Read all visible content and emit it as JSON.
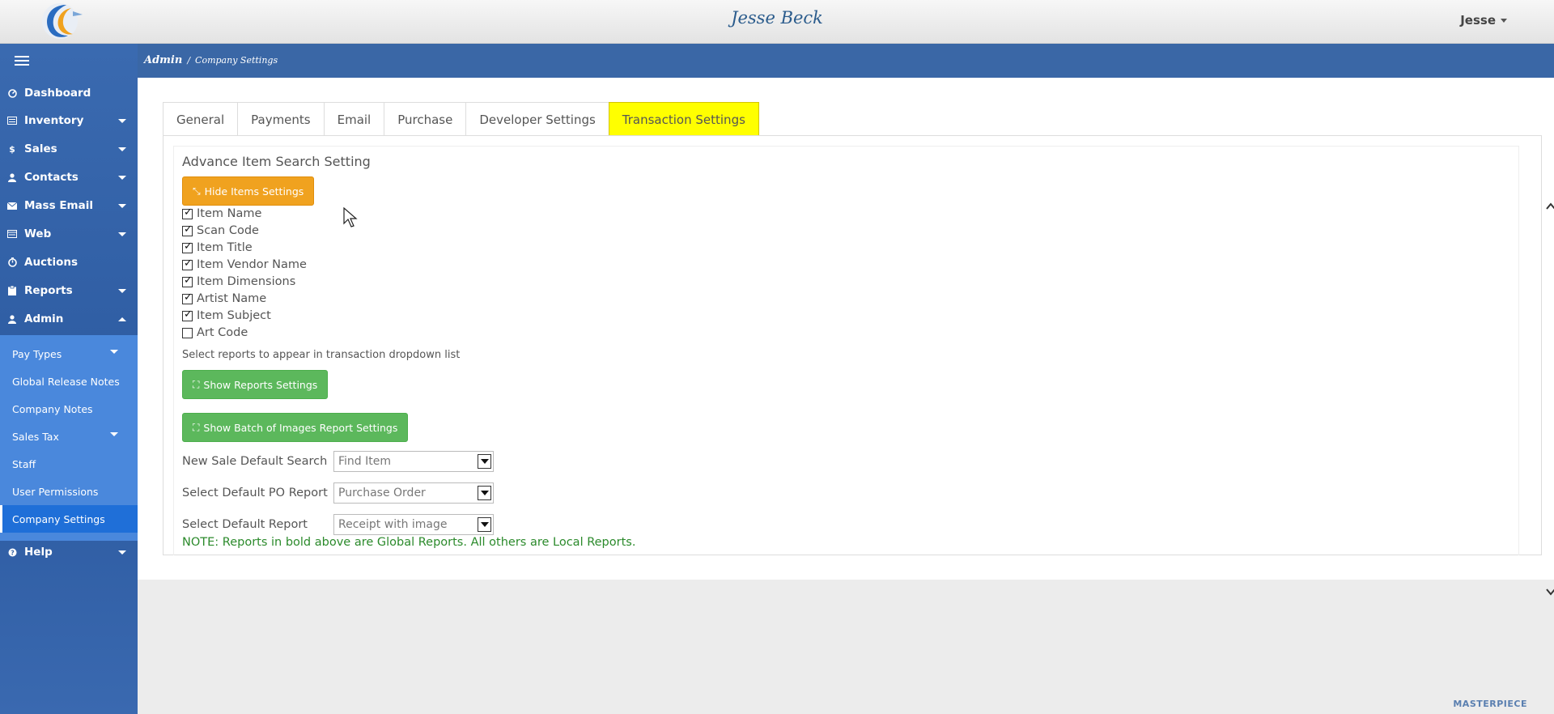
{
  "header": {
    "title": "Jesse Beck",
    "user": "Jesse"
  },
  "breadcrumb": {
    "root": "Admin",
    "separator": "/",
    "current": "Company Settings"
  },
  "sidebar": {
    "items": [
      {
        "label": "Dashboard",
        "icon": "dashboard-icon",
        "has_arrow": false
      },
      {
        "label": "Inventory",
        "icon": "inventory-icon",
        "has_arrow": true
      },
      {
        "label": "Sales",
        "icon": "dollar-icon",
        "has_arrow": true
      },
      {
        "label": "Contacts",
        "icon": "user-icon",
        "has_arrow": true
      },
      {
        "label": "Mass Email",
        "icon": "envelope-icon",
        "has_arrow": true
      },
      {
        "label": "Web",
        "icon": "web-icon",
        "has_arrow": true
      },
      {
        "label": "Auctions",
        "icon": "timer-icon",
        "has_arrow": false
      },
      {
        "label": "Reports",
        "icon": "clipboard-icon",
        "has_arrow": true
      },
      {
        "label": "Admin",
        "icon": "user-icon",
        "has_arrow": true,
        "expanded": true
      },
      {
        "label": "Help",
        "icon": "question-icon",
        "has_arrow": true
      }
    ],
    "admin_submenu": [
      {
        "label": "Pay Types",
        "has_arrow": true
      },
      {
        "label": "Global Release Notes"
      },
      {
        "label": "Company Notes"
      },
      {
        "label": "Sales Tax",
        "has_arrow": true
      },
      {
        "label": "Staff"
      },
      {
        "label": "User Permissions"
      },
      {
        "label": "Company Settings",
        "active": true
      }
    ]
  },
  "tabs": [
    "General",
    "Payments",
    "Email",
    "Purchase",
    "Developer Settings",
    "Transaction Settings"
  ],
  "active_tab": "Transaction Settings",
  "panel": {
    "section_title": "Advance Item Search Setting",
    "hide_items_button": "Hide Items Settings",
    "checkboxes": [
      {
        "label": "Item Name",
        "checked": true
      },
      {
        "label": "Scan Code",
        "checked": true
      },
      {
        "label": "Item Title",
        "checked": true
      },
      {
        "label": "Item Vendor Name",
        "checked": true
      },
      {
        "label": "Item Dimensions",
        "checked": true
      },
      {
        "label": "Artist Name",
        "checked": true
      },
      {
        "label": "Item Subject",
        "checked": true
      },
      {
        "label": "Art Code",
        "checked": false
      }
    ],
    "reports_hint": "Select reports to appear in transaction dropdown list",
    "show_reports_button": "Show Reports Settings",
    "show_batch_button": "Show Batch of Images Report Settings",
    "fields": [
      {
        "label": "New Sale Default Search",
        "value": "Find Item"
      },
      {
        "label": "Select Default PO Report",
        "value": "Purchase Order"
      },
      {
        "label": "Select Default Report",
        "value": "Receipt with image"
      }
    ],
    "note": "NOTE: Reports in bold above are Global Reports. All others are Local Reports."
  },
  "footer_brand": "MASTERPIECE",
  "colors": {
    "active_tab": "#ffff00",
    "orange_button": "#f0a21f",
    "green_button": "#5cb85c",
    "sidebar": "#2c5aa0"
  }
}
